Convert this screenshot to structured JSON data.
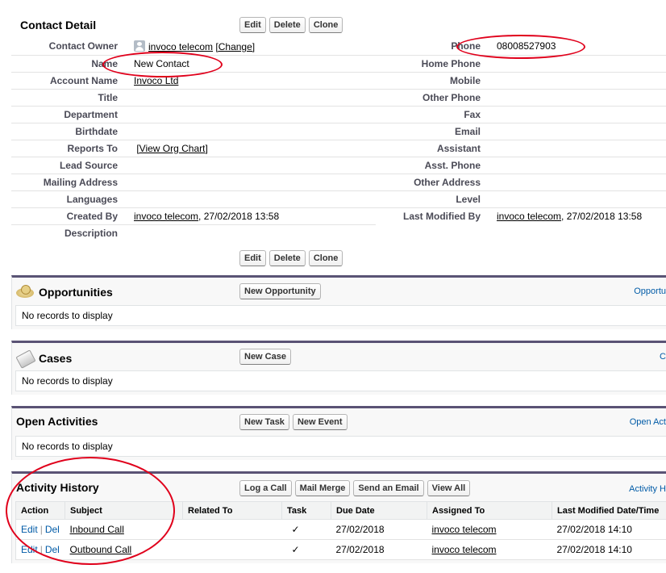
{
  "detail": {
    "title": "Contact Detail",
    "buttons": {
      "edit": "Edit",
      "delete": "Delete",
      "clone": "Clone"
    },
    "left": [
      {
        "label": "Contact Owner",
        "value": "invoco telecom",
        "extra": "[Change]"
      },
      {
        "label": "Name",
        "value": "New Contact"
      },
      {
        "label": "Account Name",
        "value": "Invoco Ltd"
      },
      {
        "label": "Title",
        "value": ""
      },
      {
        "label": "Department",
        "value": ""
      },
      {
        "label": "Birthdate",
        "value": ""
      },
      {
        "label": "Reports To",
        "value": "[View Org Chart]"
      },
      {
        "label": "Lead Source",
        "value": ""
      },
      {
        "label": "Mailing Address",
        "value": ""
      },
      {
        "label": "Languages",
        "value": ""
      },
      {
        "label": "Created By",
        "value": "invoco telecom",
        "suffix": ", 27/02/2018 13:58"
      },
      {
        "label": "Description",
        "value": ""
      }
    ],
    "right": [
      {
        "label": "Phone",
        "value": "08008527903"
      },
      {
        "label": "Home Phone",
        "value": ""
      },
      {
        "label": "Mobile",
        "value": ""
      },
      {
        "label": "Other Phone",
        "value": ""
      },
      {
        "label": "Fax",
        "value": ""
      },
      {
        "label": "Email",
        "value": ""
      },
      {
        "label": "Assistant",
        "value": ""
      },
      {
        "label": "Asst. Phone",
        "value": ""
      },
      {
        "label": "Other Address",
        "value": ""
      },
      {
        "label": "Level",
        "value": ""
      },
      {
        "label": "Last Modified By",
        "value": "invoco telecom",
        "suffix": ", 27/02/2018 13:58"
      }
    ]
  },
  "opportunities": {
    "title": "Opportunities",
    "button": "New Opportunity",
    "help": "Opportu",
    "empty": "No records to display"
  },
  "cases": {
    "title": "Cases",
    "button": "New Case",
    "help": "C",
    "empty": "No records to display"
  },
  "open_activities": {
    "title": "Open Activities",
    "buttons": {
      "task": "New Task",
      "event": "New Event"
    },
    "help": "Open Act",
    "empty": "No records to display"
  },
  "activity_history": {
    "title": "Activity History",
    "buttons": {
      "log": "Log a Call",
      "merge": "Mail Merge",
      "email": "Send an Email",
      "view": "View All"
    },
    "help": "Activity H",
    "columns": [
      "Action",
      "Subject",
      "Related To",
      "Task",
      "Due Date",
      "Assigned To",
      "Last Modified Date/Time"
    ],
    "rows": [
      {
        "edit": "Edit",
        "del": "Del",
        "subject": "Inbound Call",
        "related": "",
        "task": "✓",
        "due": "27/02/2018",
        "assigned": "invoco telecom",
        "modified": "27/02/2018 14:10"
      },
      {
        "edit": "Edit",
        "del": "Del",
        "subject": "Outbound Call",
        "related": "",
        "task": "✓",
        "due": "27/02/2018",
        "assigned": "invoco telecom",
        "modified": "27/02/2018 14:10"
      }
    ]
  },
  "colors": {
    "accent": "#5a5375",
    "link": "#015ba7",
    "annotation": "#e0001b"
  }
}
